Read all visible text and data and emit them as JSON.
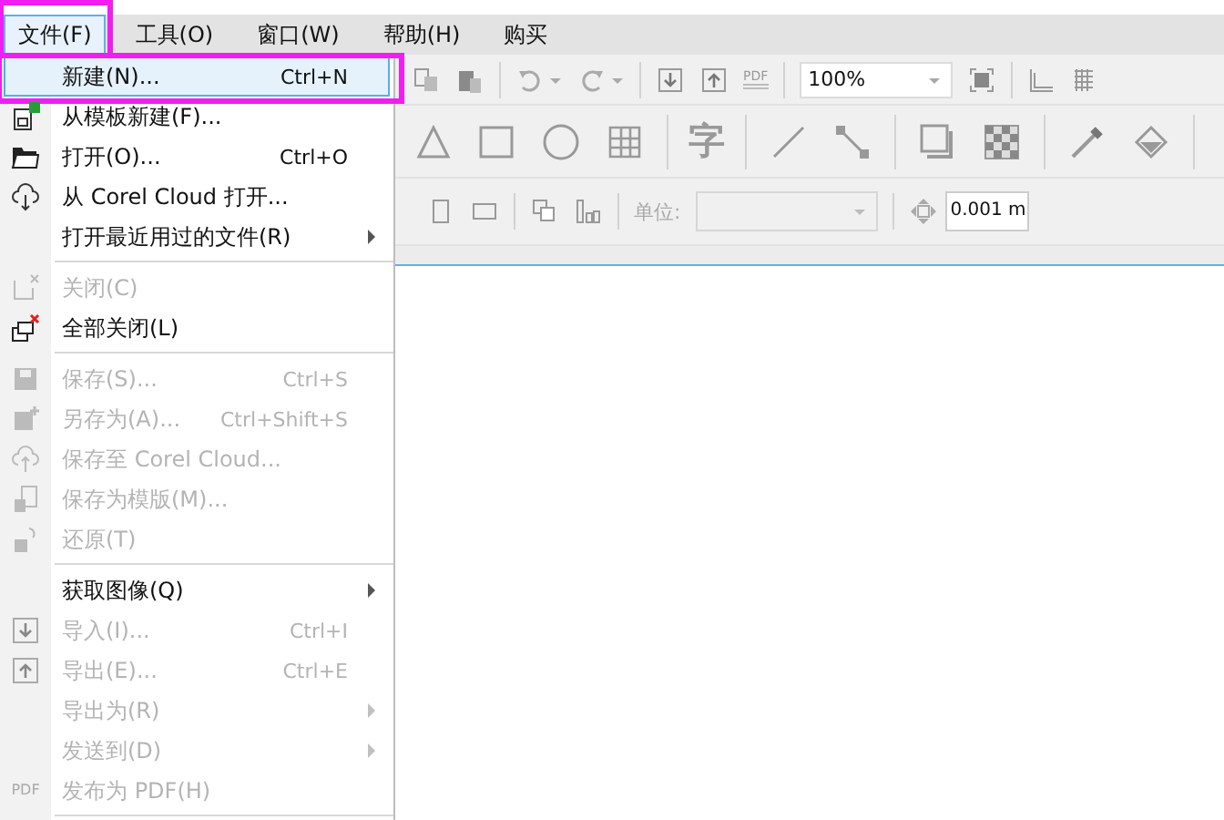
{
  "menubar": [
    {
      "label": "文件(F)",
      "selected": true,
      "annotated": true
    },
    {
      "label": "工具(O)",
      "selected": false,
      "annotated": false
    },
    {
      "label": "窗口(W)",
      "selected": false,
      "annotated": false
    },
    {
      "label": "帮助(H)",
      "selected": false,
      "annotated": false
    },
    {
      "label": "购买",
      "selected": false,
      "annotated": false
    }
  ],
  "toolbar": {
    "pdf_label": "PDF",
    "zoom_value": "100%",
    "text_tool_glyph": "字",
    "unit_label": "单位:",
    "nudge_value": "0.001 m"
  },
  "file_menu": [
    {
      "kind": "item",
      "label": "新建(N)...",
      "shortcut": "Ctrl+N",
      "disabled": false,
      "submenu": false,
      "selected": true,
      "annotated": true
    },
    {
      "kind": "item",
      "label": "从模板新建(F)...",
      "disabled": false,
      "submenu": false,
      "selected": false,
      "annotated": false
    },
    {
      "kind": "item",
      "label": "打开(O)...",
      "shortcut": "Ctrl+O",
      "disabled": false,
      "submenu": false,
      "selected": false,
      "annotated": false
    },
    {
      "kind": "item",
      "label": "从 Corel Cloud 打开...",
      "disabled": false,
      "submenu": false,
      "selected": false,
      "annotated": false
    },
    {
      "kind": "item",
      "label": "打开最近用过的文件(R)",
      "disabled": false,
      "submenu": true,
      "selected": false,
      "annotated": false
    },
    {
      "kind": "separator"
    },
    {
      "kind": "item",
      "label": "关闭(C)",
      "disabled": true,
      "submenu": false,
      "selected": false,
      "annotated": false
    },
    {
      "kind": "item",
      "label": "全部关闭(L)",
      "disabled": false,
      "submenu": false,
      "selected": false,
      "annotated": false
    },
    {
      "kind": "separator"
    },
    {
      "kind": "item",
      "label": "保存(S)...",
      "shortcut": "Ctrl+S",
      "disabled": true,
      "submenu": false,
      "selected": false,
      "annotated": false
    },
    {
      "kind": "item",
      "label": "另存为(A)...",
      "shortcut": "Ctrl+Shift+S",
      "disabled": true,
      "submenu": false,
      "selected": false,
      "annotated": false
    },
    {
      "kind": "item",
      "label": "保存至 Corel Cloud...",
      "disabled": true,
      "submenu": false,
      "selected": false,
      "annotated": false
    },
    {
      "kind": "item",
      "label": "保存为模版(M)...",
      "disabled": true,
      "submenu": false,
      "selected": false,
      "annotated": false
    },
    {
      "kind": "item",
      "label": "还原(T)",
      "disabled": true,
      "submenu": false,
      "selected": false,
      "annotated": false
    },
    {
      "kind": "separator"
    },
    {
      "kind": "item",
      "label": "获取图像(Q)",
      "disabled": false,
      "submenu": true,
      "selected": false,
      "annotated": false
    },
    {
      "kind": "item",
      "label": "导入(I)...",
      "shortcut": "Ctrl+I",
      "disabled": true,
      "submenu": false,
      "selected": false,
      "annotated": false
    },
    {
      "kind": "item",
      "label": "导出(E)...",
      "shortcut": "Ctrl+E",
      "disabled": true,
      "submenu": false,
      "selected": false,
      "annotated": false
    },
    {
      "kind": "item",
      "label": "导出为(R)",
      "disabled": true,
      "submenu": true,
      "selected": false,
      "annotated": false
    },
    {
      "kind": "item",
      "label": "发送到(D)",
      "disabled": true,
      "submenu": true,
      "selected": false,
      "annotated": false
    },
    {
      "kind": "item",
      "label": "发布为 PDF(H)",
      "icon_text": "PDF",
      "disabled": true,
      "submenu": false,
      "selected": false,
      "annotated": false
    },
    {
      "kind": "separator"
    }
  ]
}
